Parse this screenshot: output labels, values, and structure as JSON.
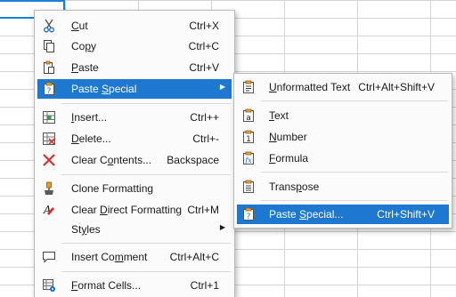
{
  "context_menu": {
    "items": [
      {
        "pre": "",
        "key": "C",
        "post": "ut",
        "accel": "Ctrl+X",
        "icon": "scissors-icon"
      },
      {
        "pre": "Co",
        "key": "p",
        "post": "y",
        "accel": "Ctrl+C",
        "icon": "copy-icon"
      },
      {
        "pre": "",
        "key": "P",
        "post": "aste",
        "accel": "Ctrl+V",
        "icon": "paste-icon"
      },
      {
        "pre": "Paste ",
        "key": "S",
        "post": "pecial",
        "accel": "",
        "icon": "paste-special-icon",
        "submenu": true,
        "highlighted": true
      },
      {
        "pre": "",
        "key": "I",
        "post": "nsert...",
        "accel": "Ctrl++",
        "icon": "insert-cells-icon"
      },
      {
        "pre": "",
        "key": "D",
        "post": "elete...",
        "accel": "Ctrl+-",
        "icon": "delete-cells-icon"
      },
      {
        "pre": "Clear C",
        "key": "o",
        "post": "ntents...",
        "accel": "Backspace",
        "icon": "clear-x-icon"
      },
      {
        "pre": "Clone Formatting",
        "key": "",
        "post": "",
        "accel": "",
        "icon": "paintbrush-icon"
      },
      {
        "pre": "Clear ",
        "key": "D",
        "post": "irect Formatting",
        "accel": "Ctrl+M",
        "icon": "clear-formatting-icon"
      },
      {
        "pre": "St",
        "key": "y",
        "post": "les",
        "accel": "",
        "icon": "",
        "submenu": true
      },
      {
        "pre": "Insert Co",
        "key": "m",
        "post": "ment",
        "accel": "Ctrl+Alt+C",
        "icon": "comment-icon"
      },
      {
        "pre": "",
        "key": "F",
        "post": "ormat Cells...",
        "accel": "Ctrl+1",
        "icon": "format-cells-icon"
      }
    ]
  },
  "paste_special_submenu": {
    "items": [
      {
        "pre": "",
        "key": "U",
        "post": "nformatted Text",
        "accel": "Ctrl+Alt+Shift+V",
        "icon": "unformatted-text-icon"
      },
      {
        "pre": "",
        "key": "T",
        "post": "ext",
        "accel": "",
        "icon": "text-icon"
      },
      {
        "pre": "",
        "key": "N",
        "post": "umber",
        "accel": "",
        "icon": "number-icon"
      },
      {
        "pre": "",
        "key": "F",
        "post": "ormula",
        "accel": "",
        "icon": "formula-icon"
      },
      {
        "pre": "Trans",
        "key": "p",
        "post": "ose",
        "accel": "",
        "icon": "transpose-icon"
      },
      {
        "pre": "Paste ",
        "key": "S",
        "post": "pecial...",
        "accel": "Ctrl+Shift+V",
        "icon": "paste-special-icon",
        "highlighted": true
      }
    ]
  },
  "submenu_arrow": "▶"
}
